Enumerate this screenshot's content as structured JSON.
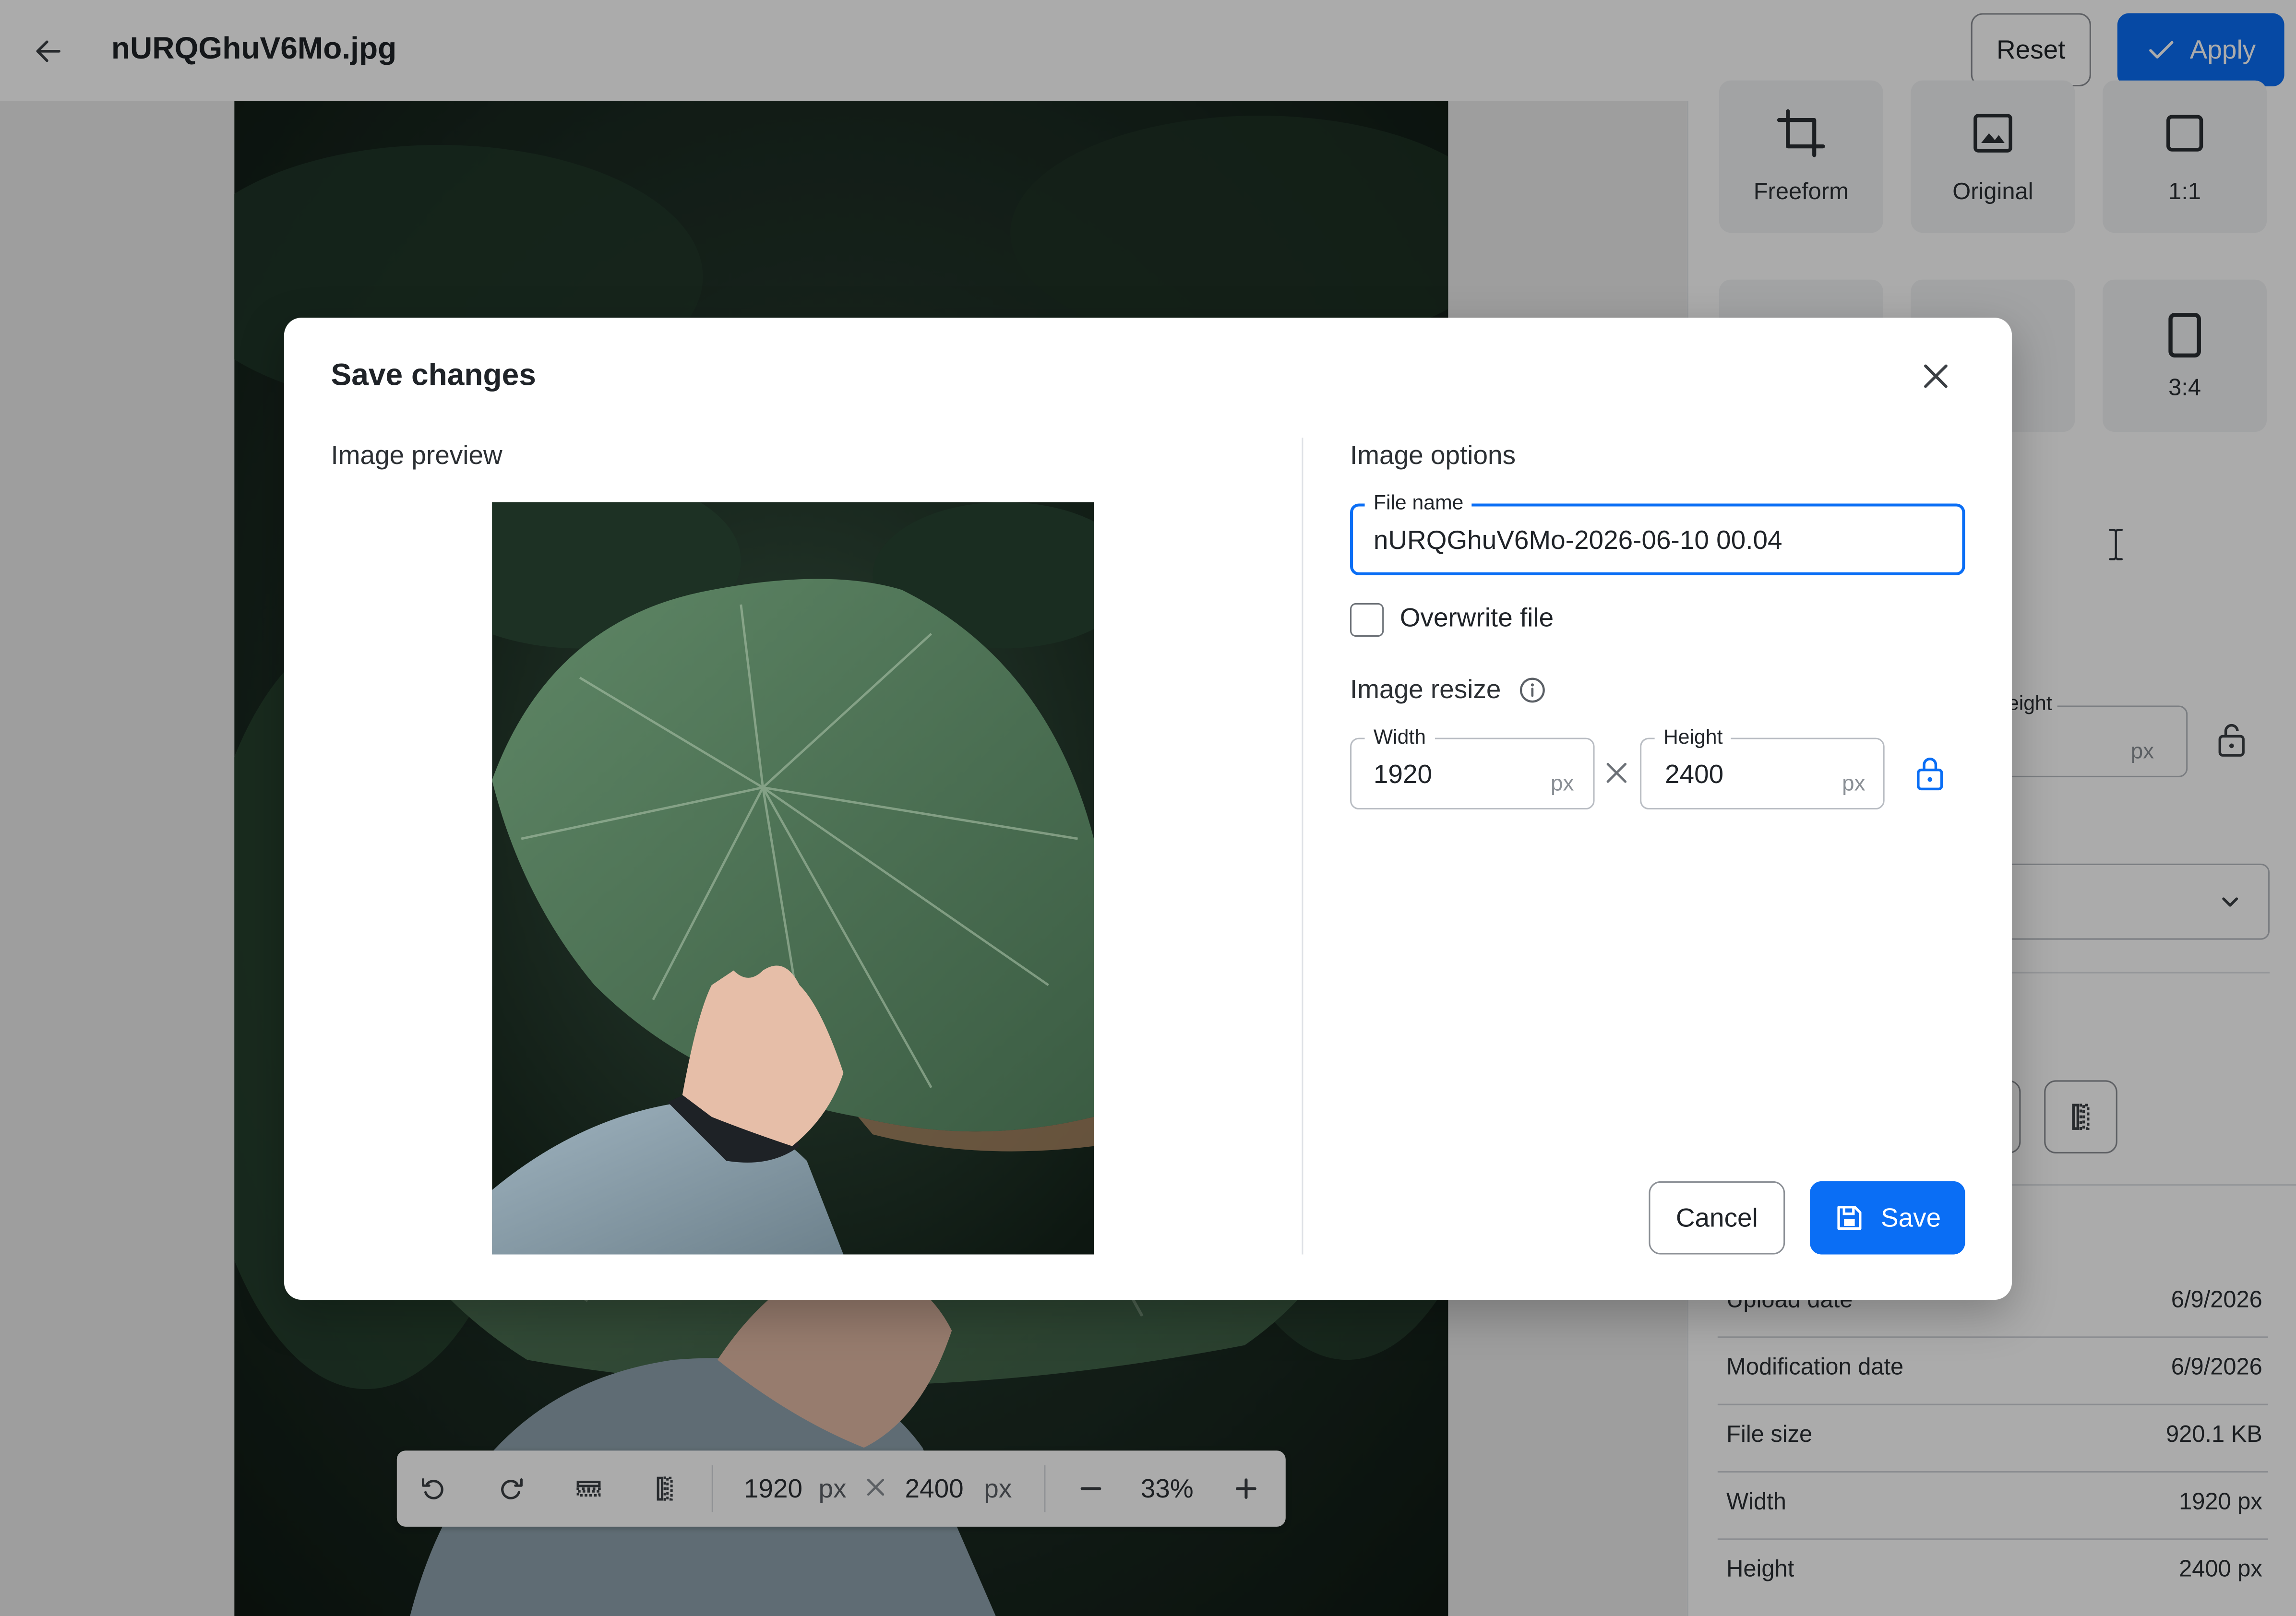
{
  "header": {
    "title": "nURQGhuV6Mo.jpg",
    "reset_label": "Reset",
    "apply_label": "Apply"
  },
  "toolbar": {
    "width": "1920",
    "height": "2400",
    "unit": "px",
    "zoom": "33%"
  },
  "crop_presets": [
    {
      "label": "Freeform",
      "icon": "crop-icon"
    },
    {
      "label": "Original",
      "icon": "image-icon"
    },
    {
      "label": "1:1",
      "icon": "square-icon"
    },
    {
      "label": "3:4",
      "icon": "portrait-rect-icon"
    }
  ],
  "side_resize": {
    "height_label_partial": "eight",
    "unit": "px"
  },
  "file_info": [
    {
      "key": "Upload date",
      "value": "6/9/2026"
    },
    {
      "key": "Modification date",
      "value": "6/9/2026"
    },
    {
      "key": "File size",
      "value": "920.1 KB"
    },
    {
      "key": "Width",
      "value": "1920 px"
    },
    {
      "key": "Height",
      "value": "2400 px"
    }
  ],
  "dialog": {
    "title": "Save changes",
    "preview_label": "Image preview",
    "options_label": "Image options",
    "file_name_label": "File name",
    "file_name_value": "nURQGhuV6Mo-2026-06-10 00.04",
    "overwrite_label": "Overwrite file",
    "overwrite_checked": false,
    "resize_label": "Image resize",
    "width_label": "Width",
    "width_value": "1920",
    "height_label": "Height",
    "height_value": "2400",
    "unit": "px",
    "cancel_label": "Cancel",
    "save_label": "Save"
  },
  "colors": {
    "accent": "#0a6ef5",
    "overlay": "rgba(0,0,0,0.33)"
  }
}
